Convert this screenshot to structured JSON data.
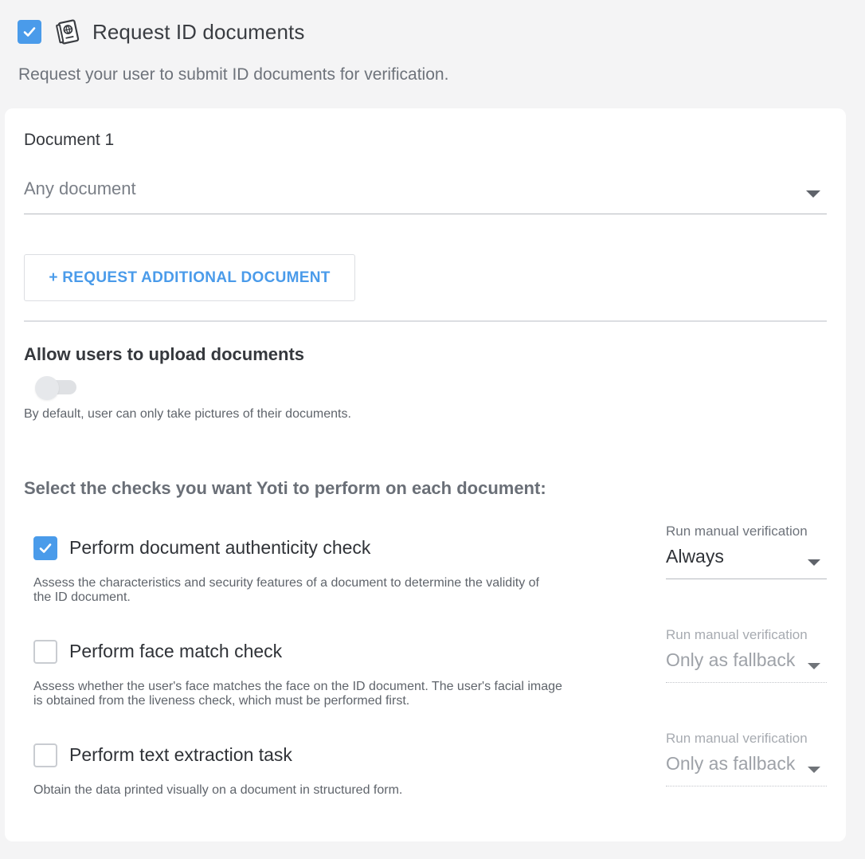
{
  "header": {
    "title": "Request ID documents",
    "description": "Request your user to submit ID documents for verification.",
    "checked": true,
    "icon": "passport-icon"
  },
  "document": {
    "label": "Document 1",
    "selected": "Any document"
  },
  "add_button_label": "+ REQUEST ADDITIONAL DOCUMENT",
  "upload": {
    "title": "Allow users to upload documents",
    "enabled": false,
    "description": "By default, user can only take pictures of their documents."
  },
  "checks_title": "Select the checks you want Yoti to perform on each document:",
  "checks": [
    {
      "label": "Perform document authenticity check",
      "checked": true,
      "description_lines": [
        "Assess the characteristics and security features of a document to determine the validity of",
        "the ID document."
      ],
      "manual_label": "Run manual verification",
      "manual_value": "Always",
      "manual_enabled": true
    },
    {
      "label": "Perform face match check",
      "checked": false,
      "description_lines": [
        "Assess whether the user's face matches the face on the ID document. The user's facial image",
        "is obtained from the liveness check, which must be performed first."
      ],
      "manual_label": "Run manual verification",
      "manual_value": "Only as fallback",
      "manual_enabled": false
    },
    {
      "label": "Perform text extraction task",
      "checked": false,
      "description_lines": [
        "Obtain the data printed visually on a document in structured form."
      ],
      "manual_label": "Run manual verification",
      "manual_value": "Only as fallback",
      "manual_enabled": false
    }
  ],
  "colors": {
    "accent": "#4a9bea",
    "background": "#f4f4f5",
    "card": "#ffffff"
  }
}
